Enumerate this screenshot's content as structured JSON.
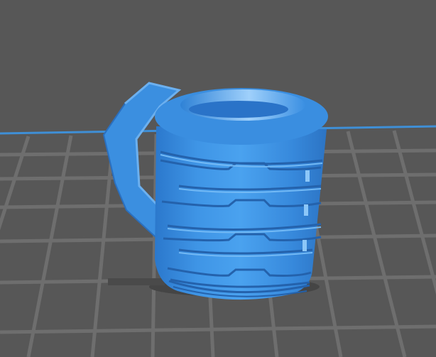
{
  "viewport": {
    "background": "#575757",
    "grid_color": "#6e6e6e",
    "axis_color": "#3f8fd6"
  },
  "model": {
    "object": "mug",
    "color": "#3b8fe0",
    "shade_color": "#2a72c2",
    "highlight_color": "#6fb3f3"
  }
}
